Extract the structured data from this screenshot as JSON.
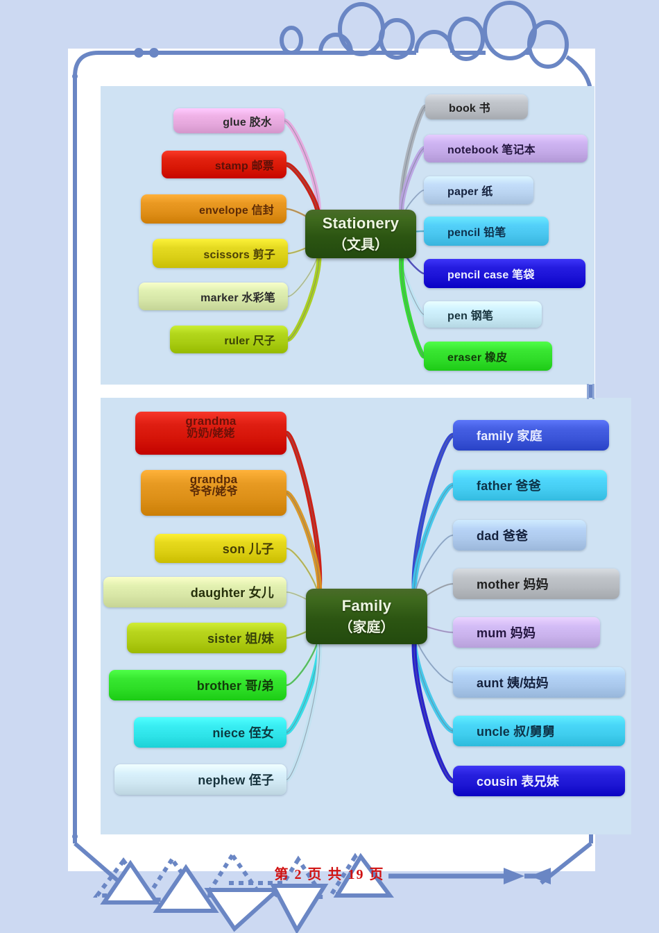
{
  "page": {
    "footer_text": "第 2 页 共 19 页",
    "background_color": "#ccd9f2",
    "sheet_color": "#ffffff",
    "accent_color": "#6a86c4",
    "footer_color": "#d01212"
  },
  "maps": [
    {
      "id": "stationery",
      "center": {
        "en": "Stationery",
        "cn": "（文具）"
      },
      "panel_color": "#cfe2f3",
      "left_items": [
        {
          "en": "glue",
          "cn": "胶水",
          "color": "#e6a8dd",
          "text": "#2a2a2a",
          "link": "#e6a8dd"
        },
        {
          "en": "stamp",
          "cn": "邮票",
          "color": "#d81705",
          "text": "#5a1008",
          "link": "#c8170a"
        },
        {
          "en": "envelope",
          "cn": "信封",
          "color": "#e08f18",
          "text": "#5d2b06",
          "link": "#d79020"
        },
        {
          "en": "scissors",
          "cn": "剪子",
          "color": "#dbd017",
          "text": "#4a3f06",
          "link": "#d7cd2a"
        },
        {
          "en": "marker",
          "cn": "水彩笔",
          "color": "#d6e6a8",
          "text": "#2a2a2a",
          "link": "#d5e6a4"
        },
        {
          "en": "ruler",
          "cn": "尺子",
          "color": "#a8cc11",
          "text": "#3b4405",
          "link": "#a9cd18"
        }
      ],
      "right_items": [
        {
          "en": "book",
          "cn": "书",
          "color": "#b8bcc2",
          "text": "#1f1f1f",
          "link": "#aab0b8"
        },
        {
          "en": "notebook",
          "cn": "笔记本",
          "color": "#c4aae8",
          "text": "#241640",
          "link": "#b9a3e2"
        },
        {
          "en": "paper",
          "cn": "纸",
          "color": "#b9d3f0",
          "text": "#14213d",
          "link": "#a8c4e8"
        },
        {
          "en": "pencil",
          "cn": "铅笔",
          "color": "#49c6ef",
          "text": "#0d2f4a",
          "link": "#3fbfe8"
        },
        {
          "en": "pencil case",
          "cn": "笔袋",
          "color": "#1b12d6",
          "text": "#eef0ff",
          "link": "#2018c9"
        },
        {
          "en": "pen",
          "cn": "钢笔",
          "color": "#c7e9f5",
          "text": "#17333d",
          "link": "#bfe4f2"
        },
        {
          "en": "eraser",
          "cn": "橡皮",
          "color": "#2fdc28",
          "text": "#123b0a",
          "link": "#2fd92a"
        }
      ]
    },
    {
      "id": "family",
      "center": {
        "en": "Family",
        "cn": "（家庭）"
      },
      "panel_color": "#cfe2f3",
      "left_items": [
        {
          "en": "grandma",
          "cn": "奶奶/姥姥",
          "color": "#d51408",
          "text": "#6b1108",
          "link": "#cc1508",
          "two_line": true
        },
        {
          "en": "grandpa",
          "cn": "爷爷/姥爷",
          "color": "#dd9018",
          "text": "#5a2a06",
          "link": "#d99320",
          "two_line": true
        },
        {
          "en": "son",
          "cn": "儿子",
          "color": "#dccf12",
          "text": "#463e05",
          "link": "#d7cd2a"
        },
        {
          "en": "daughter",
          "cn": "女儿",
          "color": "#d8e6a6",
          "text": "#26300b",
          "link": "#d5e6a4"
        },
        {
          "en": "sister",
          "cn": "姐/妹",
          "color": "#aecb13",
          "text": "#36420a",
          "link": "#a9cd18"
        },
        {
          "en": "brother",
          "cn": "哥/弟",
          "color": "#2ddd26",
          "text": "#123b0a",
          "link": "#2fd92a"
        },
        {
          "en": "niece",
          "cn": "侄女",
          "color": "#2ee3e8",
          "text": "#0c3a40",
          "link": "#2fdbe6"
        },
        {
          "en": "nephew",
          "cn": "侄子",
          "color": "#cfe7f2",
          "text": "#17333d",
          "link": "#c2e2f0"
        }
      ],
      "right_items": [
        {
          "en": "family",
          "cn": "家庭",
          "color": "#3a54d8",
          "text": "#e8ecff",
          "link": "#2c3fcf"
        },
        {
          "en": "father",
          "cn": "爸爸",
          "color": "#45cdf2",
          "text": "#0d3348",
          "link": "#3fc6ea"
        },
        {
          "en": "dad",
          "cn": "爸爸",
          "color": "#adc9ec",
          "text": "#14213d",
          "link": "#9fbfe6"
        },
        {
          "en": "mother",
          "cn": "妈妈",
          "color": "#b6babf",
          "text": "#1f1f1f",
          "link": "#aab0b8"
        },
        {
          "en": "mum",
          "cn": "妈妈",
          "color": "#c9b2ec",
          "text": "#241640",
          "link": "#bda4e4"
        },
        {
          "en": "aunt",
          "cn": "姨/姑妈",
          "color": "#a9c8ec",
          "text": "#14213d",
          "link": "#9fbfe6"
        },
        {
          "en": "uncle",
          "cn": "叔/舅舅",
          "color": "#3fcdee",
          "text": "#0d3348",
          "link": "#3fc6ea"
        },
        {
          "en": "cousin",
          "cn": "表兄妹",
          "color": "#1d16d4",
          "text": "#eef0ff",
          "link": "#2018c9"
        }
      ]
    }
  ]
}
